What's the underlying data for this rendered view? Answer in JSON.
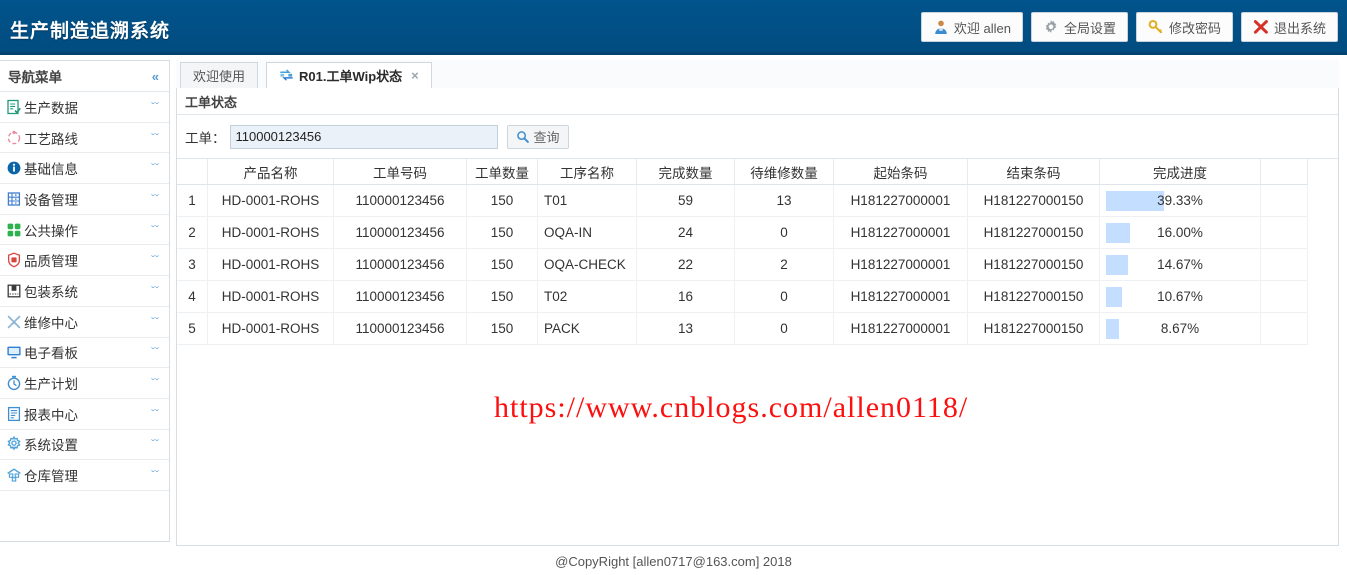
{
  "header": {
    "brand": "生产制造追溯系统",
    "brand_bg": "#01548c",
    "buttons": [
      {
        "label": "欢迎 allen",
        "icon": "user-icon"
      },
      {
        "label": "全局设置",
        "icon": "gear-icon"
      },
      {
        "label": "修改密码",
        "icon": "key-icon"
      },
      {
        "label": "退出系统",
        "icon": "close-x-icon"
      }
    ]
  },
  "sidebar": {
    "title": "导航菜单",
    "collapse_icon": "«",
    "expand_arrow": "ˇˇ",
    "items": [
      {
        "label": "生产数据",
        "icon": "production-data-icon",
        "color": "#1f9b7a"
      },
      {
        "label": "工艺路线",
        "icon": "route-icon",
        "color": "#e98aa0"
      },
      {
        "label": "基础信息",
        "icon": "info-icon",
        "color": "#0b63a8"
      },
      {
        "label": "设备管理",
        "icon": "equipment-icon",
        "color": "#3f7fd0"
      },
      {
        "label": "公共操作",
        "icon": "grid-blocks-icon",
        "color": "#2eb24f"
      },
      {
        "label": "品质管理",
        "icon": "quality-shield-icon",
        "color": "#d8453c"
      },
      {
        "label": "包装系统",
        "icon": "package-icon",
        "color": "#3a3a3a"
      },
      {
        "label": "维修中心",
        "icon": "tools-icon",
        "color": "#8fb8d8"
      },
      {
        "label": "电子看板",
        "icon": "monitor-icon",
        "color": "#2f7fd6"
      },
      {
        "label": "生产计划",
        "icon": "clock-icon",
        "color": "#3f8fd0"
      },
      {
        "label": "报表中心",
        "icon": "report-icon",
        "color": "#3f8fd0"
      },
      {
        "label": "系统设置",
        "icon": "settings-gear-icon",
        "color": "#4a9fd8"
      },
      {
        "label": "仓库管理",
        "icon": "warehouse-icon",
        "color": "#4a9fd8"
      }
    ]
  },
  "tabs": [
    {
      "label": "欢迎使用",
      "active": false,
      "closable": false
    },
    {
      "label": "R01.工单Wip状态",
      "active": true,
      "closable": true,
      "icon": "transfer-icon",
      "close_label": "×"
    }
  ],
  "panel": {
    "title": "工单状态",
    "search": {
      "label": "工单：",
      "input_value": "110000123456",
      "input_placeholder": "",
      "button_label": "查询",
      "button_icon": "search-icon"
    }
  },
  "table": {
    "columns": [
      "",
      "产品名称",
      "工单号码",
      "工单数量",
      "工序名称",
      "完成数量",
      "待维修数量",
      "起始条码",
      "结束条码",
      "完成进度",
      ""
    ],
    "rows": [
      {
        "idx": "1",
        "product": "HD-0001-ROHS",
        "wo": "110000123456",
        "qty": "150",
        "process": "T01",
        "done": "59",
        "repair": "13",
        "start_barcode": "H181227000001",
        "end_barcode": "H181227000150",
        "progress_text": "39.33%",
        "progress_value": 39.33
      },
      {
        "idx": "2",
        "product": "HD-0001-ROHS",
        "wo": "110000123456",
        "qty": "150",
        "process": "OQA-IN",
        "done": "24",
        "repair": "0",
        "start_barcode": "H181227000001",
        "end_barcode": "H181227000150",
        "progress_text": "16.00%",
        "progress_value": 16.0
      },
      {
        "idx": "3",
        "product": "HD-0001-ROHS",
        "wo": "110000123456",
        "qty": "150",
        "process": "OQA-CHECK",
        "done": "22",
        "repair": "2",
        "start_barcode": "H181227000001",
        "end_barcode": "H181227000150",
        "progress_text": "14.67%",
        "progress_value": 14.67
      },
      {
        "idx": "4",
        "product": "HD-0001-ROHS",
        "wo": "110000123456",
        "qty": "150",
        "process": "T02",
        "done": "16",
        "repair": "0",
        "start_barcode": "H181227000001",
        "end_barcode": "H181227000150",
        "progress_text": "10.67%",
        "progress_value": 10.67
      },
      {
        "idx": "5",
        "product": "HD-0001-ROHS",
        "wo": "110000123456",
        "qty": "150",
        "process": "PACK",
        "done": "13",
        "repair": "0",
        "start_barcode": "H181227000001",
        "end_barcode": "H181227000150",
        "progress_text": "8.67%",
        "progress_value": 8.67
      }
    ],
    "progress_bar_color": "#c3deff"
  },
  "watermark": "https://www.cnblogs.com/allen0118/",
  "footer": "@CopyRight [allen0717@163.com] 2018"
}
